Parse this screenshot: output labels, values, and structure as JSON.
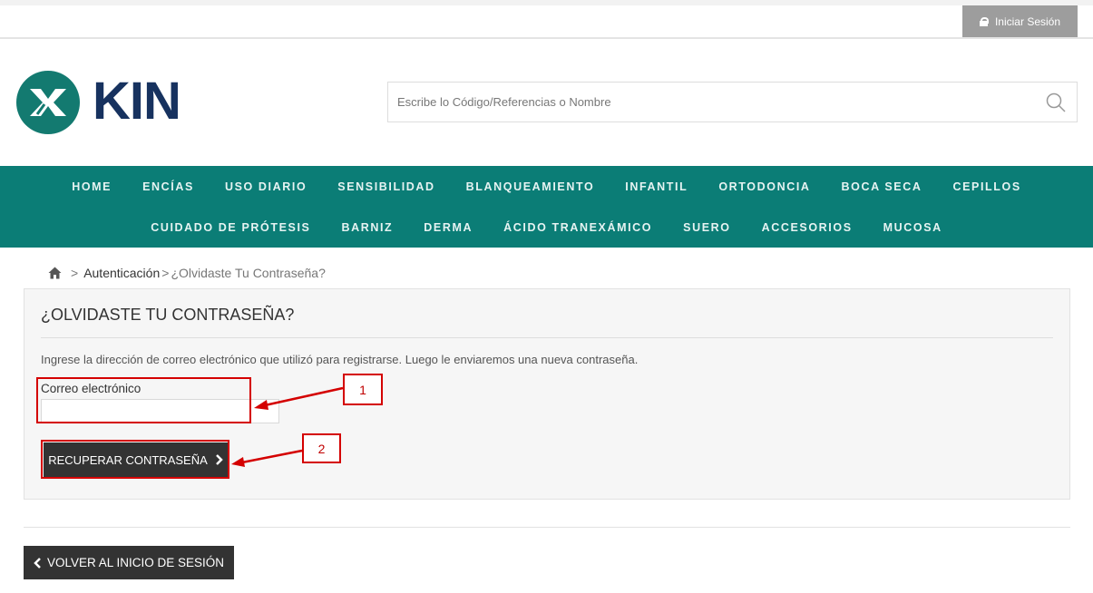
{
  "header": {
    "login_label": "Iniciar Sesión",
    "logo_text": "KIN",
    "search": {
      "placeholder": "Escribe lo Código/Referencias o Nombre",
      "value": ""
    }
  },
  "nav": {
    "row1": [
      "HOME",
      "ENCÍAS",
      "USO DIARIO",
      "SENSIBILIDAD",
      "BLANQUEAMIENTO",
      "INFANTIL",
      "ORTODONCIA",
      "BOCA SECA",
      "CEPILLOS"
    ],
    "row2": [
      "CUIDADO DE PRÓTESIS",
      "BARNIZ",
      "DERMA",
      "ÁCIDO TRANEXÁMICO",
      "SUERO",
      "ACCESORIOS",
      "MUCOSA"
    ]
  },
  "breadcrumb": {
    "separator": ">",
    "parent": "Autenticación",
    "current": "¿Olvidaste Tu Contraseña?"
  },
  "form": {
    "title": "¿OLVIDASTE TU CONTRASEÑA?",
    "description": "Ingrese la dirección de correo electrónico que utilizó para registrarse. Luego le enviaremos una nueva contraseña.",
    "email_label": "Correo electrónico",
    "email_value": "",
    "submit_label": "RECUPERAR CONTRASEÑA"
  },
  "annotations": [
    "1",
    "2"
  ],
  "back_label": "VOLVER AL INICIO DE SESIÓN",
  "colors": {
    "nav_bg": "#0b7d76",
    "logo_circle": "#137a70",
    "logo_text": "#17325f",
    "button_dark": "#333333",
    "annotation": "#d40000",
    "login_bg": "#9d9d9d"
  }
}
